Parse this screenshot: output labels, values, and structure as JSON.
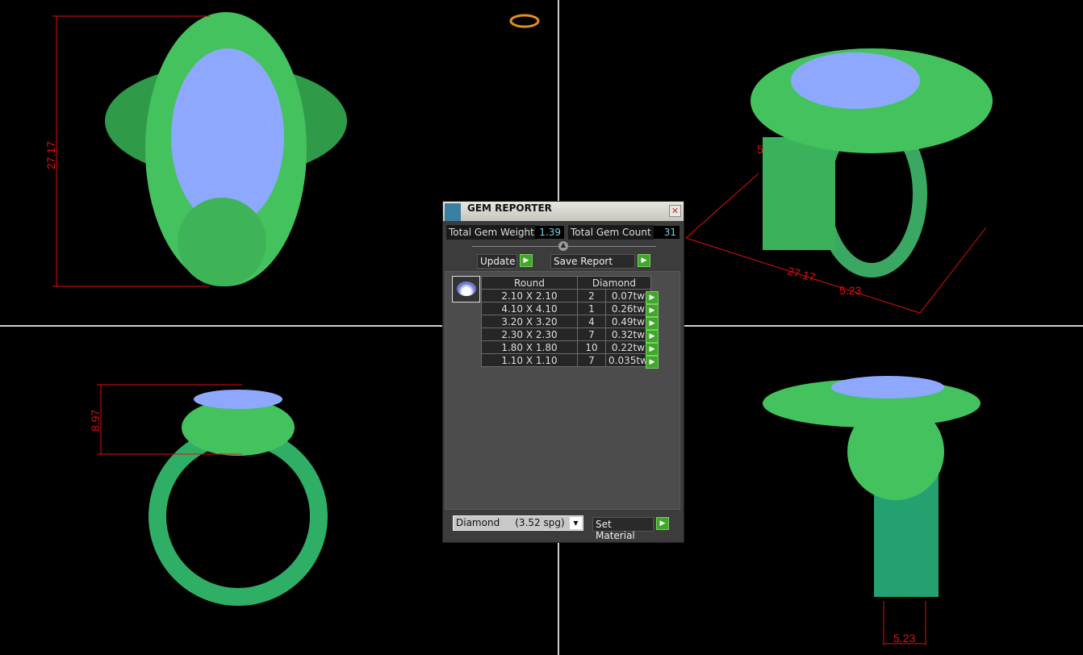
{
  "dialog": {
    "title": "GEM REPORTER",
    "total_weight_label": "Total Gem Weight",
    "total_weight": "1.39",
    "total_count_label": "Total Gem Count",
    "total_count": "31",
    "update": "Update",
    "save_report": "Save Report",
    "set_material": "Set Material",
    "material_select": "Diamond     (3.52 spg)",
    "table": {
      "headers": [
        "Round",
        "Diamond"
      ],
      "rows": [
        {
          "size": "2.10 X 2.10",
          "count": "2",
          "weight": "0.07tw"
        },
        {
          "size": "4.10 X 4.10",
          "count": "1",
          "weight": "0.26tw"
        },
        {
          "size": "3.20 X 3.20",
          "count": "4",
          "weight": "0.49tw"
        },
        {
          "size": "2.30 X 2.30",
          "count": "7",
          "weight": "0.32tw"
        },
        {
          "size": "1.80 X 1.80",
          "count": "10",
          "weight": "0.22tw"
        },
        {
          "size": "1.10 X 1.10",
          "count": "7",
          "weight": "0.035tw"
        }
      ]
    }
  },
  "dimensions": {
    "top_height": "27.17",
    "front_height": "8.97",
    "persp_length": "27.17",
    "persp_width": "5.23",
    "persp_small": "5",
    "side_width": "5.23"
  },
  "colors": {
    "model": "#3fbf5a",
    "gem": "#8fa8ff",
    "prong": "#7a1fa8",
    "dimension": "#e01010"
  }
}
